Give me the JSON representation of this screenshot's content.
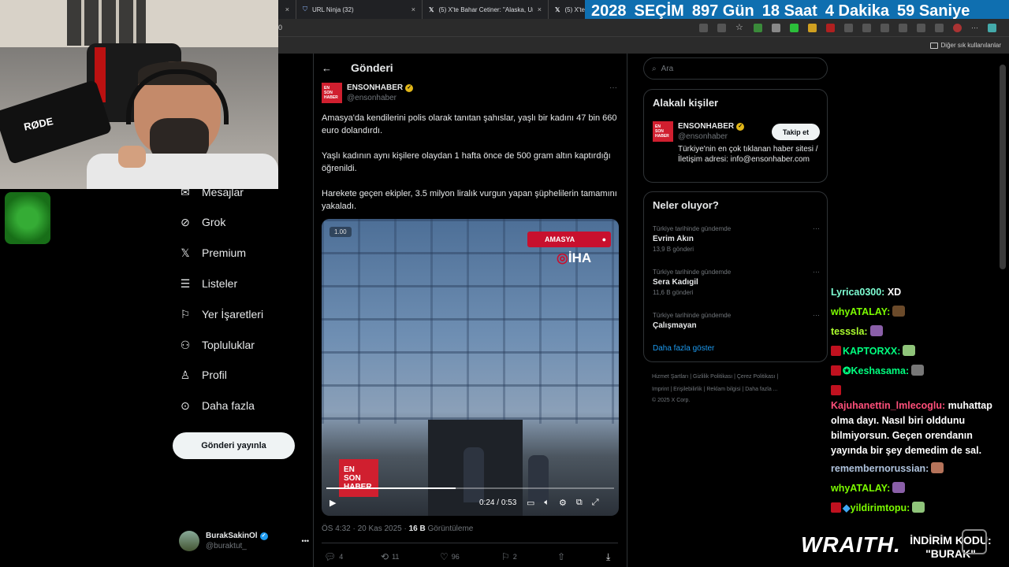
{
  "browser": {
    "tabs": [
      {
        "label": "",
        "close": "×"
      },
      {
        "label": "URL Ninja (32)",
        "close": "×"
      },
      {
        "label": "(5) X'te Bahar Cetiner: \"Alaska, Ur",
        "close": "×"
      },
      {
        "label": "(5) X'te",
        "close": "×"
      }
    ],
    "address_text": "0",
    "bookmarks_other": "Diğer sık kullanılanlar"
  },
  "countdown": {
    "year": "2028",
    "label": "SEÇİM",
    "days": "897",
    "days_label": "Gün",
    "hours": "18",
    "hours_label": "Saat",
    "minutes": "4",
    "minutes_label": "Dakika",
    "seconds": "59",
    "seconds_label": "Saniye"
  },
  "webcam": {
    "mic_brand": "RØDE"
  },
  "nav": {
    "items": [
      {
        "label": "Mesajlar",
        "icon": "mail-icon"
      },
      {
        "label": "Grok",
        "icon": "grok-icon"
      },
      {
        "label": "Premium",
        "icon": "x-logo-icon"
      },
      {
        "label": "Listeler",
        "icon": "list-icon"
      },
      {
        "label": "Yer İşaretleri",
        "icon": "bookmark-icon"
      },
      {
        "label": "Topluluklar",
        "icon": "communities-icon"
      },
      {
        "label": "Profil",
        "icon": "profile-icon"
      },
      {
        "label": "Daha fazla",
        "icon": "more-circle-icon"
      }
    ],
    "post_button": "Gönderi yayınla",
    "account": {
      "name": "BurakSakinOl",
      "handle": "@buraktut_",
      "more": "•••"
    }
  },
  "post": {
    "header_title": "Gönderi",
    "author_name": "ENSONHABER",
    "author_handle": "@ensonhaber",
    "logo_lines": [
      "EN",
      "SON",
      "HABER"
    ],
    "paragraphs": [
      "Amasya'da kendilerini polis olarak tanıtan şahıslar, yaşlı bir kadını 47 bin 660 euro dolandırdı.",
      "Yaşlı kadının aynı kişilere olaydan 1 hafta önce de 500 gram altın kaptırdığı öğrenildi.",
      "Harekete geçen ekipler, 3.5 milyon liralık vurgun yapan şüphelilerin tamamını yakaladı."
    ],
    "video": {
      "speed_badge": "1.00",
      "location_tag": "AMASYA",
      "agency": "İHA",
      "current_time": "0:24",
      "duration": "0:53",
      "progress": 0.45
    },
    "meta_time": "ÖS 4:32 · 20 Kas 2025 · ",
    "views_count": "16 B",
    "views_label": " Görüntüleme",
    "stats": {
      "replies": "4",
      "reposts": "11",
      "likes": "96",
      "bookmarks": "2"
    }
  },
  "sidebar": {
    "search_placeholder": "Ara",
    "relevant_title": "Alakalı kişiler",
    "person": {
      "name": "ENSONHABER",
      "handle": "@ensonhaber",
      "bio": "Türkiye'nin en çok tıklanan haber sitesi / İletişim adresi: info@ensonhaber.com",
      "follow": "Takip et"
    },
    "trends_title": "Neler oluyor?",
    "trends": [
      {
        "context": "Türkiye tarihinde gündemde",
        "name": "Evrim Akın",
        "count": "13,9 B gönderi"
      },
      {
        "context": "Türkiye tarihinde gündemde",
        "name": "Sera Kadıgil",
        "count": "11,6 B gönderi"
      },
      {
        "context": "Türkiye tarihinde gündemde",
        "name": "Çalışmayan",
        "count": ""
      }
    ],
    "show_more": "Daha fazla göster",
    "footer": {
      "line1": "Hizmet Şartları  |  Gizlilik Politikası  |  Çerez Politikası  |",
      "line2": "Imprint  |  Erişilebilirlik  |  Reklam bilgisi  |  Daha fazla ...",
      "line3": "© 2025 X Corp."
    }
  },
  "chat": [
    {
      "user": "Lyrica0300:",
      "msg": " XD",
      "color": "#7fffd4",
      "badge": false,
      "emote": false
    },
    {
      "user": "whyATALAY:",
      "msg": "",
      "color": "#7cfc00",
      "badge": false,
      "emote": true
    },
    {
      "user": "tesssla:",
      "msg": "",
      "color": "#adff2f",
      "badge": false,
      "emote": true
    },
    {
      "user": "KAPTORXX:",
      "msg": "",
      "color": "#00ff7f",
      "badge": true,
      "emote": true
    },
    {
      "user": "✪Keshasama:",
      "msg": "",
      "color": "#00ff7f",
      "badge": true,
      "emote": true
    },
    {
      "user": "Kajuhanettin_lmlecoglu:",
      "msg": " muhattap olma dayı. Nasıl biri olddunu bilmiyorsun. Geçen orendanın yayında bir şey demedim de sal.",
      "color": "#ff4f7a",
      "badge": true,
      "emote": false
    },
    {
      "user": "remembernorussian:",
      "msg": "",
      "color": "#b0c4de",
      "badge": false,
      "emote": true
    },
    {
      "user": "whyATALAY:",
      "msg": "",
      "color": "#7cfc00",
      "badge": false,
      "emote": true
    },
    {
      "user": "yildirimtopu:",
      "msg": "",
      "color": "#7cfc00",
      "badge": true,
      "emote": true
    }
  ],
  "sponsor": {
    "brand": "WRAITH.",
    "line1": "İNDİRİM KODU:",
    "line2": "\"BURAK\""
  }
}
